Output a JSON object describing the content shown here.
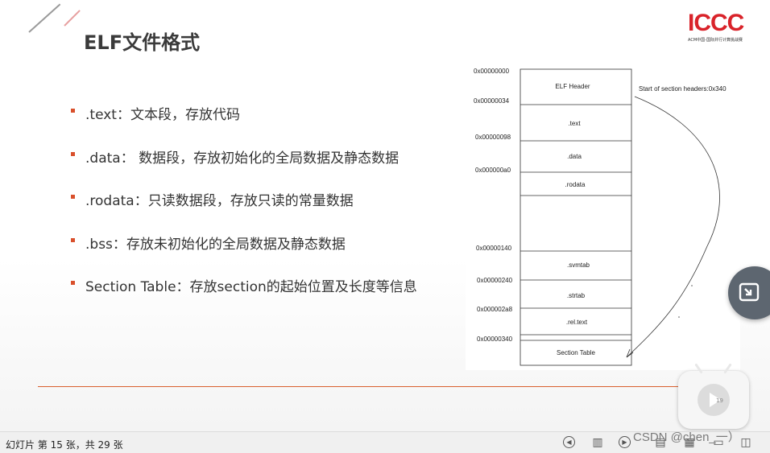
{
  "slide": {
    "title": "ELF文件格式",
    "logo": {
      "mark": "ICCC",
      "subtitle": "ACM中国-国际并行计算挑战赛"
    },
    "bullets": [
      ".text：文本段，存放代码",
      ".data： 数据段，存放初始化的全局数据及静态数据",
      ".rodata：只读数据段，存放只读的常量数据",
      ".bss：存放未初始化的全局数据及静态数据",
      "Section Table：存放section的起始位置及长度等信息"
    ],
    "diagram": {
      "addresses": [
        "0x00000000",
        "0x00000034",
        "0x00000098",
        "0x000000a0",
        "0x00000140",
        "0x00000240",
        "0x000002a8",
        "0x00000340"
      ],
      "segments": [
        "ELF Header",
        ".text",
        ".data",
        ".rodata",
        ".svmtab",
        ".strtab",
        ".rel.text",
        "Section Table"
      ],
      "note": "Start of section headers:0x340"
    },
    "slide_number": "19"
  },
  "status": {
    "text": "幻灯片 第 15 张，共 29 张",
    "watermark": "CSDN @chen_一）"
  },
  "icons": {
    "float_button": "picture-in-picture-icon",
    "play": "play-icon",
    "prev": "previous-icon",
    "notes": "notes-icon",
    "next": "next-icon",
    "view_normal": "normal-view-icon",
    "view_sorter": "slide-sorter-icon",
    "view_reading": "reading-view-icon"
  }
}
